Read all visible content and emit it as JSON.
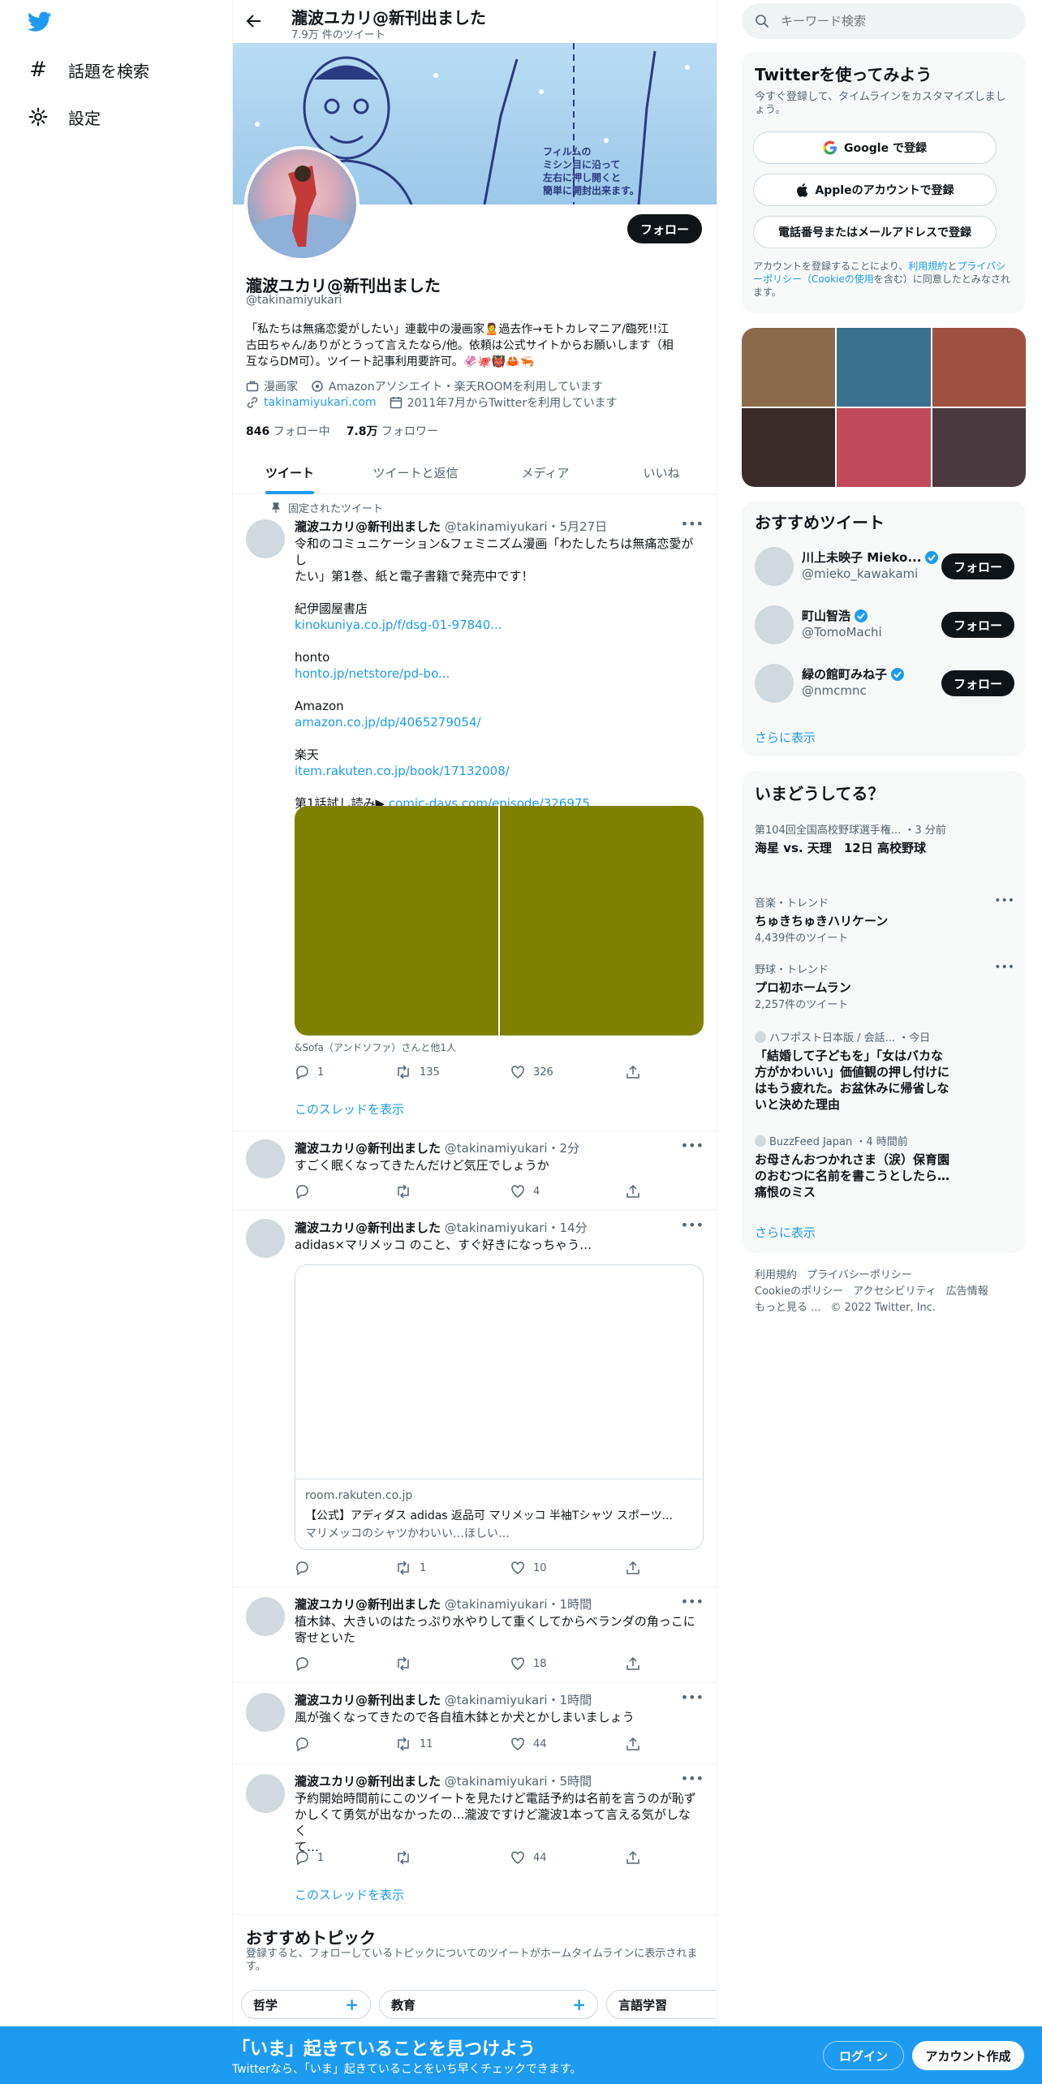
{
  "nav": {
    "explore": "話題を検索",
    "settings": "設定"
  },
  "header": {
    "name": "瀧波ユカリ@新刊出ました",
    "tweet_count": "7.9万 件のツイート"
  },
  "banner": {
    "caption_lines": [
      "フィルムの",
      "ミシン目に沿って",
      "左右に押し開くと",
      "簡単に開封出来ます。"
    ]
  },
  "profile": {
    "follow": "フォロー",
    "name": "瀧波ユカリ@新刊出ました",
    "handle": "@takinamiyukari",
    "bio_1": "「私たちは無痛恋愛がしたい」連載中の漫画家🙎過去作→モトカレマニア/臨死!!江",
    "bio_2": "古田ちゃん/ありがとうって言えたなら/他。依頼は公式サイトからお願いします（相",
    "bio_3": "互ならDM可）。ツイート記事利用要許可。🦑🐙👹🦀🦐",
    "category": "漫画家",
    "location": "Amazonアソシエイト・楽天ROOMを利用しています",
    "website": "takinamiyukari.com",
    "joined": "2011年7月からTwitterを利用しています",
    "following_count": "846",
    "following_label": "フォロー中",
    "followers_count": "7.8万",
    "followers_label": "フォロワー"
  },
  "tabs": [
    "ツイート",
    "ツイートと返信",
    "メディア",
    "いいね"
  ],
  "pinned_label": "固定されたツイート",
  "tweets": [
    {
      "name": "瀧波ユカリ@新刊出ました",
      "meta": "@takinamiyukari・5月27日",
      "lines": [
        "令和のコミュニケーション&フェミニズム漫画「わたしたちは無痛恋愛がし",
        "たい」第1巻、紙と電子書籍で発売中です！"
      ],
      "store1": "紀伊國屋書店",
      "link1": "kinokuniya.co.jp/f/dsg-01-97840...",
      "store2": "honto",
      "link2": "honto.jp/netstore/pd-bo...",
      "store3": "Amazon",
      "link3": "amazon.co.jp/dp/4065279054/",
      "store4": "楽天",
      "link4": "item.rakuten.co.jp/book/17132008/",
      "preview_label": "第1話試し読み▶",
      "preview_link": "comic-days.com/episode/326975...",
      "tagged": "&Sofa（アンドソファ）さんと他1人",
      "replies": "1",
      "retweets": "135",
      "likes": "326",
      "thread": "このスレッドを表示"
    },
    {
      "name": "瀧波ユカリ@新刊出ました",
      "meta": "@takinamiyukari・2分",
      "text": "すごく眠くなってきたんだけど気圧でしょうか",
      "replies": "",
      "retweets": "",
      "likes": "4"
    },
    {
      "name": "瀧波ユカリ@新刊出ました",
      "meta": "@takinamiyukari・14分",
      "text": "adidas×マリメッコ のこと、すぐ好きになっちゃう…",
      "card_domain": "room.rakuten.co.jp",
      "card_title": "【公式】アディダス adidas 返品可 マリメッコ 半袖Tシャツ スポーツ...",
      "card_desc": "マリメッコのシャツかわいい…ほしい…",
      "replies": "",
      "retweets": "1",
      "likes": "10"
    },
    {
      "name": "瀧波ユカリ@新刊出ました",
      "meta": "@takinamiyukari・1時間",
      "lines": [
        "植木鉢、大きいのはたっぷり水やりして重くしてからベランダの角っこに",
        "寄せといた"
      ],
      "replies": "",
      "retweets": "",
      "likes": "18"
    },
    {
      "name": "瀧波ユカリ@新刊出ました",
      "meta": "@takinamiyukari・1時間",
      "text": "風が強くなってきたので各自植木鉢とか犬とかしまいましょう",
      "replies": "",
      "retweets": "11",
      "likes": "44"
    },
    {
      "name": "瀧波ユカリ@新刊出ました",
      "meta": "@takinamiyukari・5時間",
      "lines": [
        "予約開始時間前にこのツイートを見たけど電話予約は名前を言うのが恥ず",
        "かしくて勇気が出なかったの…瀧波ですけど瀧波1本って言える気がしなく",
        "て…"
      ],
      "replies": "1",
      "retweets": "",
      "likes": "44",
      "thread": "このスレッドを表示"
    }
  ],
  "topics": {
    "title": "おすすめトピック",
    "desc_1": "登録すると、フォローしているトピックについてのツイートがホームタイムラインに表示されま",
    "desc_2": "す。",
    "items": [
      "哲学",
      "教育",
      "言語学習"
    ]
  },
  "search": {
    "placeholder": "キーワード検索"
  },
  "signup": {
    "title": "Twitterを使ってみよう",
    "desc": "今すぐ登録して、タイムラインをカスタマイズしましょう。",
    "google": "Google で登録",
    "apple": "Appleのアカウントで登録",
    "phone": "電話番号またはメールアドレスで登録",
    "terms_1": "アカウントを登録することにより、",
    "terms_link1": "利用規約",
    "terms_2": "と",
    "terms_link2": "プライバシーポリシー（Cookieの使用",
    "terms_3": "を含む）に同意したとみなされます。"
  },
  "media_colors": [
    "#8a6a4a",
    "#3a7090",
    "#a05040",
    "#3a2a2a",
    "#c04a5a",
    "#4a3a40"
  ],
  "recommended": {
    "title": "おすすめツイート",
    "users": [
      {
        "name": "川上未映子 Mieko...",
        "handle": "@mieko_kawakami",
        "follow": "フォロー"
      },
      {
        "name": "町山智浩",
        "handle": "@TomoMachi",
        "follow": "フォロー"
      },
      {
        "name": "緑の館町みね子",
        "handle": "@nmcmnc",
        "follow": "フォロー"
      }
    ],
    "more": "さらに表示"
  },
  "trends": {
    "title": "いまどうしてる？",
    "items": [
      {
        "meta": "第104回全国高校野球選手権...  ・3 分前",
        "title": "海星 vs. 天理　12日 高校野球"
      },
      {
        "meta": "音楽・トレンド",
        "title": "ちゅきちゅきハリケーン",
        "count": "4,439件のツイート"
      },
      {
        "meta": "野球・トレンド",
        "title": "プロ初ホームラン",
        "count": "2,257件のツイート"
      },
      {
        "meta": "ハフポスト日本版 / 会話...  ・今日",
        "title": "「結婚して子どもを」「女はバカな方がかわいい」価値観の押し付けにはもう疲れた。お盆休みに帰省しないと決めた理由"
      },
      {
        "meta": "BuzzFeed Japan  ・4 時間前",
        "title": "お母さんおつかれさま（涙）保育園のおむつに名前を書こうとしたら…痛恨のミス"
      }
    ],
    "more": "さらに表示"
  },
  "footer": {
    "l1a": "利用規約",
    "l1b": "プライバシーポリシー",
    "l2a": "Cookieのポリシー",
    "l2b": "アクセシビリティ",
    "l2c": "広告情報",
    "l3a": "もっと見る ...",
    "l3b": "© 2022 Twitter, Inc."
  },
  "bottom": {
    "title": "「いま」起きていることを見つけよう",
    "sub": "Twitterなら、「いま」起きていることをいち早くチェックできます。",
    "login": "ログイン",
    "signup": "アカウント作成"
  },
  "colors": {
    "accent": "#1d9bf0",
    "dark": "#0f1419",
    "muted": "#536471",
    "panel": "#f7f9f9",
    "media_olive": "#808000"
  }
}
